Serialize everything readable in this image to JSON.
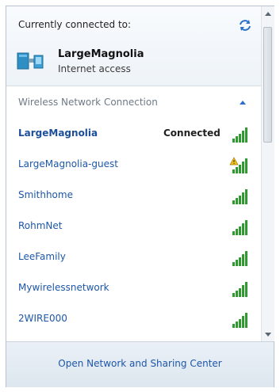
{
  "header": {
    "label": "Currently connected to:",
    "network_name": "LargeMagnolia",
    "network_status": "Internet access"
  },
  "group": {
    "title": "Wireless Network Connection"
  },
  "networks": [
    {
      "name": "LargeMagnolia",
      "state": "Connected",
      "signal_bars": 5,
      "secured": true
    },
    {
      "name": "LargeMagnolia-guest",
      "state": "",
      "signal_bars": 5,
      "secured": false
    },
    {
      "name": "Smithhome",
      "state": "",
      "signal_bars": 5,
      "secured": true
    },
    {
      "name": "RohmNet",
      "state": "",
      "signal_bars": 5,
      "secured": true
    },
    {
      "name": "LeeFamily",
      "state": "",
      "signal_bars": 5,
      "secured": true
    },
    {
      "name": "Mywirelessnetwork",
      "state": "",
      "signal_bars": 5,
      "secured": true
    },
    {
      "name": "2WIRE000",
      "state": "",
      "signal_bars": 5,
      "secured": true
    }
  ],
  "footer": {
    "link": "Open Network and Sharing Center"
  },
  "colors": {
    "link": "#1d57a8",
    "signal": "#2f9a2f"
  }
}
